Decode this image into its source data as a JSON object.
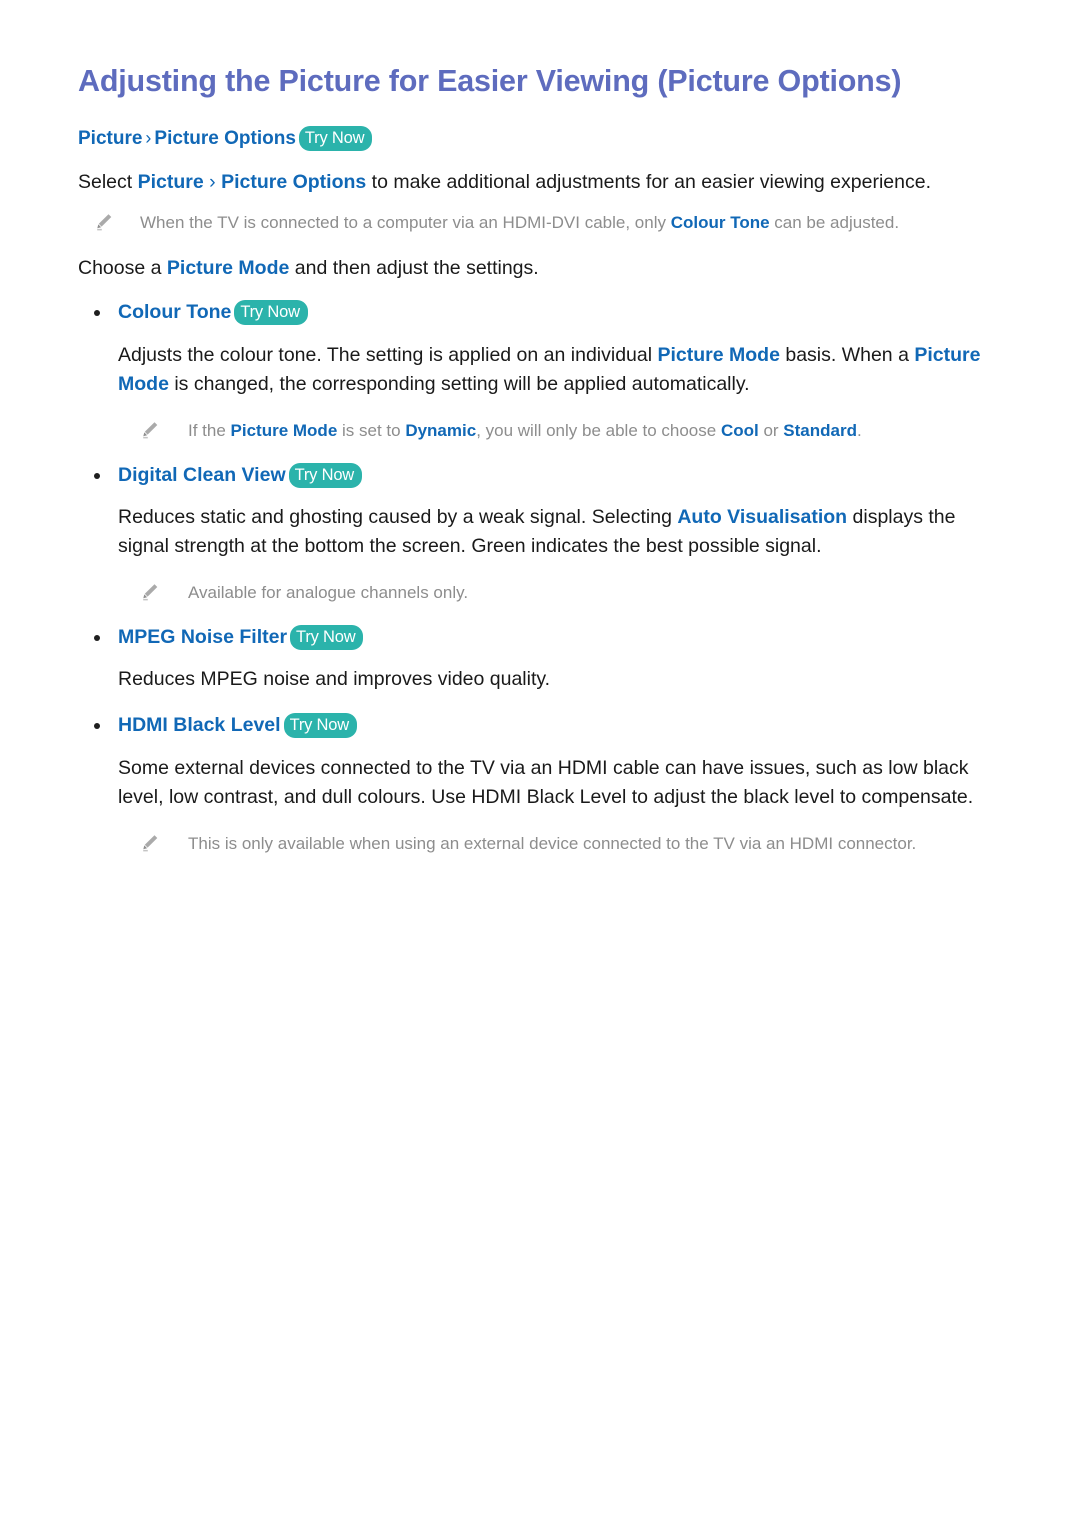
{
  "document": {
    "title": "Adjusting the Picture for Easier Viewing (Picture Options)",
    "try_now_label": "Try Now",
    "breadcrumb": {
      "item1": "Picture",
      "separator": "›",
      "item2": "Picture Options"
    },
    "intro": {
      "select_word": "Select ",
      "link1": "Picture",
      "separator": " › ",
      "link2": "Picture Options",
      "rest": " to make additional adjustments for an easier viewing experience."
    },
    "note_hdmi_dvi": {
      "part1": "When the TV is connected to a computer via an HDMI-DVI cable, only ",
      "link1": "Colour Tone",
      "part2": " can be adjusted."
    },
    "choose_line": {
      "part1": "Choose a ",
      "link1": "Picture Mode",
      "part2": " and then adjust the settings."
    },
    "colour_tone": {
      "heading": "Colour Tone",
      "body_part1": "Adjusts the colour tone. The setting is applied on an individual ",
      "body_link1": "Picture Mode",
      "body_part2": " basis. When a ",
      "body_link2": "Picture Mode",
      "body_part3": " is changed, the corresponding setting will be applied automatically.",
      "note_part1": "If the ",
      "note_link1": "Picture Mode",
      "note_part2": " is set to ",
      "note_link2": "Dynamic",
      "note_part3": ", you will only be able to choose ",
      "note_link3": "Cool",
      "note_part4": " or ",
      "note_link4": "Standard",
      "note_part5": "."
    },
    "digital_clean_view": {
      "heading": "Digital Clean View",
      "body_part1": "Reduces static and ghosting caused by a weak signal. Selecting ",
      "body_link1": "Auto Visualisation",
      "body_part2": " displays the signal strength at the bottom the screen. Green indicates the best possible signal.",
      "note": "Available for analogue channels only."
    },
    "mpeg_noise_filter": {
      "heading": "MPEG Noise Filter",
      "body": "Reduces MPEG noise and improves video quality."
    },
    "hdmi_black_level": {
      "heading": "HDMI Black Level",
      "body": "Some external devices connected to the TV via an HDMI cable can have issues, such as low black level, low contrast, and dull colours. Use HDMI Black Level to adjust the black level to compensate.",
      "note": "This is only available when using an external device connected to the TV via an HDMI connector."
    },
    "colors": {
      "title": "#5e6cbe",
      "link": "#1168b6",
      "badge_bg": "#2bb3ab",
      "badge_text": "#ffffff",
      "body_text": "#1a1a1a",
      "note_text": "#8d8d8d",
      "background": "#ffffff"
    }
  }
}
